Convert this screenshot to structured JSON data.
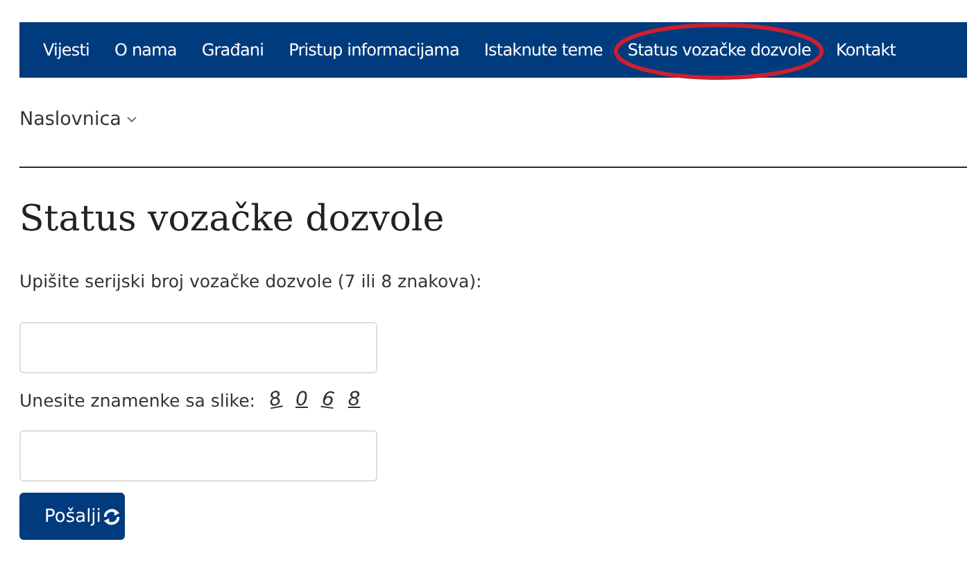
{
  "nav": {
    "items": [
      {
        "label": "Vijesti",
        "circled": false
      },
      {
        "label": "O nama",
        "circled": false
      },
      {
        "label": "Građani",
        "circled": false
      },
      {
        "label": "Pristup informacijama",
        "circled": false
      },
      {
        "label": "Istaknute teme",
        "circled": false
      },
      {
        "label": "Status vozačke dozvole",
        "circled": true
      },
      {
        "label": "Kontakt",
        "circled": false
      }
    ]
  },
  "breadcrumb": {
    "label": "Naslovnica"
  },
  "title": "Status vozačke dozvole",
  "form": {
    "serial_label": "Upišite serijski broj vozačke dozvole (7 ili 8 znakova):",
    "captcha_label": "Unesite znamenke sa slike:",
    "captcha_digits": [
      "8",
      "0",
      "6",
      "8"
    ],
    "submit": "Pošalji"
  }
}
